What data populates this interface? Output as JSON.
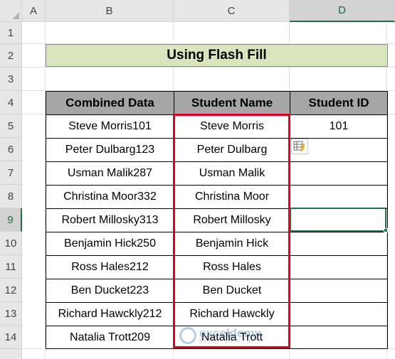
{
  "columns": [
    "A",
    "B",
    "C",
    "D"
  ],
  "rows": [
    "1",
    "2",
    "3",
    "4",
    "5",
    "6",
    "7",
    "8",
    "9",
    "10",
    "11",
    "12",
    "13",
    "14"
  ],
  "title": "Using Flash Fill",
  "table": {
    "headers": [
      "Combined Data",
      "Student Name",
      "Student ID"
    ],
    "rows": [
      {
        "combined": "Steve Morris101",
        "name": "Steve Morris",
        "id": "101"
      },
      {
        "combined": "Peter Dulbarg123",
        "name": "Peter Dulbarg",
        "id": ""
      },
      {
        "combined": "Usman Malik287",
        "name": "Usman Malik",
        "id": ""
      },
      {
        "combined": "Christina Moor332",
        "name": "Christina Moor",
        "id": ""
      },
      {
        "combined": "Robert Millosky313",
        "name": "Robert Millosky",
        "id": ""
      },
      {
        "combined": "Benjamin Hick250",
        "name": "Benjamin Hick",
        "id": ""
      },
      {
        "combined": "Ross Hales212",
        "name": "Ross Hales",
        "id": ""
      },
      {
        "combined": "Ben Ducket223",
        "name": "Ben Ducket",
        "id": ""
      },
      {
        "combined": "Richard Hawckly212",
        "name": "Richard Hawckly",
        "id": ""
      },
      {
        "combined": "Natalia Trott209",
        "name": "Natalia Trott",
        "id": ""
      }
    ]
  },
  "selected_cell": "D9",
  "flash_fill_icon": "flash-fill-options-icon",
  "watermark": {
    "main": "exceldemy",
    "sub": "EXCEL · DATA · BI"
  },
  "colors": {
    "header_fill": "#a6a6a6",
    "title_fill": "#d8e4bc",
    "highlight_border": "#e0001b",
    "selection": "#217346"
  }
}
